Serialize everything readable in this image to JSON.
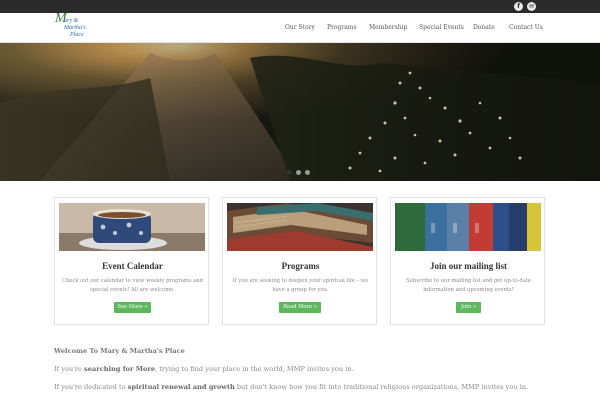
{
  "site": {
    "logo_text_1": "M",
    "logo_text_2": "ary &",
    "logo_text_3": "Martha's",
    "logo_text_4": "Place"
  },
  "social": {
    "facebook_label": "f",
    "email_label": "✉"
  },
  "nav": {
    "items": [
      {
        "label": "Our Story"
      },
      {
        "label": "Programs"
      },
      {
        "label": "Membership"
      },
      {
        "label": "Special Events"
      },
      {
        "label": "Donate"
      },
      {
        "label": "Contact Us"
      }
    ]
  },
  "slider": {
    "slide_count": 3,
    "active_slide": 1
  },
  "cards": [
    {
      "title": "Event Calendar",
      "text": "Check out our calendar to view weekly programs and special events! All are welcome.",
      "button": "See More »"
    },
    {
      "title": "Programs",
      "text": "If you are seeking to deepen your spiritual life – we have a group for you.",
      "button": "Read More »"
    },
    {
      "title": "Join our mailing list",
      "text": "Subscribe to our mailing list and get up-to-date information and upcoming events!",
      "button": "Join »"
    }
  ],
  "welcome": {
    "heading": "Welcome To Mary & Martha's Place",
    "p1_a": "If you're ",
    "p1_b": "searching for More",
    "p1_c": ", trying to find your place in the world, MMP invites you in.",
    "p2_a": "If you're dedicated to ",
    "p2_b": "spiritual renewal and growth",
    "p2_c": " but don't know how you fit into traditional religious organizations, MMP invites you in."
  },
  "colors": {
    "topbar": "#2b2b2b",
    "button_green": "#5cb85c",
    "logo_blue": "#2f6aa5",
    "logo_green": "#3a7d3a"
  }
}
